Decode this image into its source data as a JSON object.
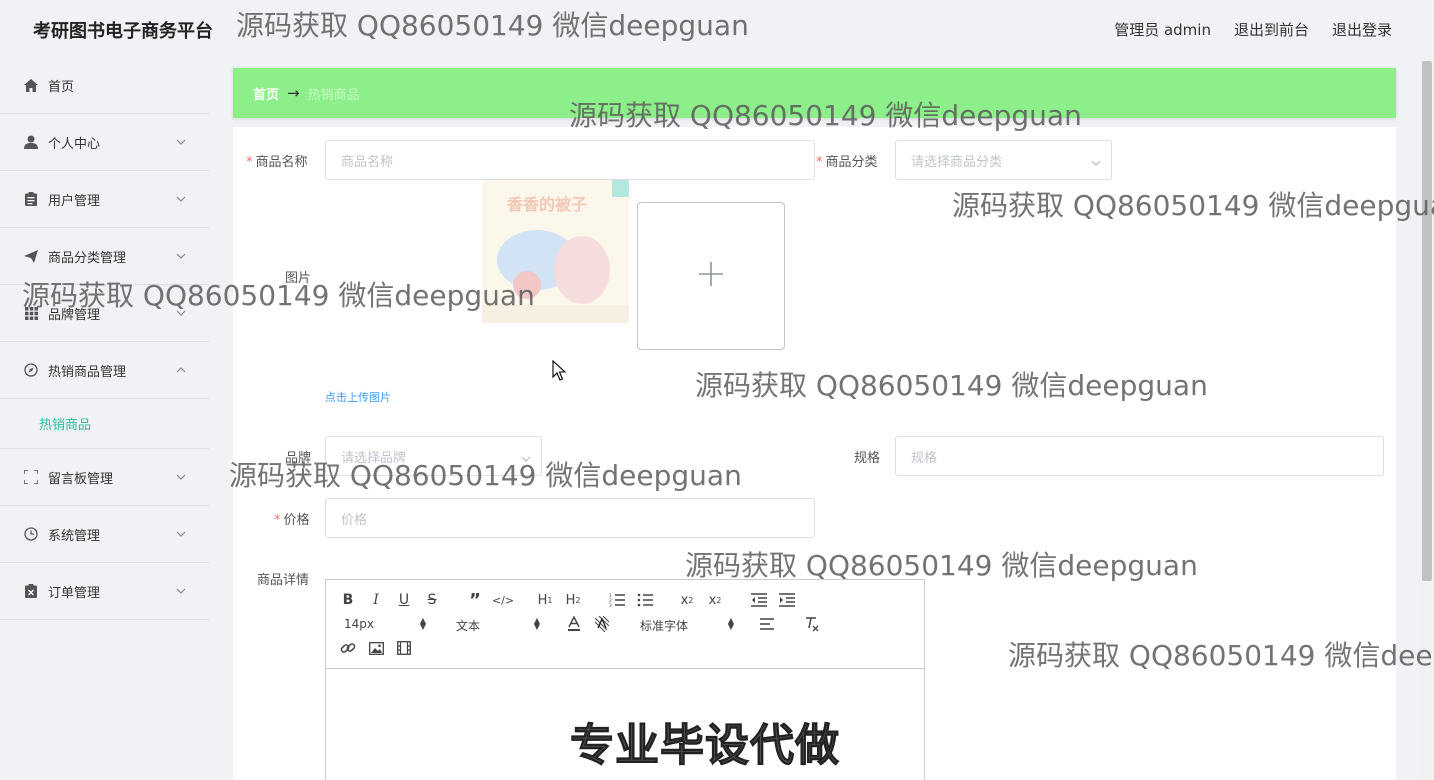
{
  "app": {
    "title": "考研图书电子商务平台"
  },
  "topnav": {
    "user": "管理员 admin",
    "front": "退出到前台",
    "logout": "退出登录"
  },
  "sidebar": {
    "items": [
      {
        "label": "首页",
        "icon": "home-icon"
      },
      {
        "label": "个人中心",
        "icon": "user-icon"
      },
      {
        "label": "用户管理",
        "icon": "clipboard-icon"
      },
      {
        "label": "商品分类管理",
        "icon": "send-icon"
      },
      {
        "label": "品牌管理",
        "icon": "grid-icon"
      },
      {
        "label": "热销商品管理",
        "icon": "compass-icon"
      },
      {
        "label": "留言板管理",
        "icon": "fullscreen-icon"
      },
      {
        "label": "系统管理",
        "icon": "clock-icon"
      },
      {
        "label": "订单管理",
        "icon": "document-icon"
      }
    ],
    "subitem": "热销商品"
  },
  "breadcrumb": {
    "home": "首页",
    "separator": "→",
    "current": "热销商品"
  },
  "form": {
    "name_label": "商品名称",
    "name_placeholder": "商品名称",
    "category_label": "商品分类",
    "category_placeholder": "请选择商品分类",
    "image_label": "图片",
    "upload_text": "点击上传图片",
    "brand_label": "品牌",
    "brand_placeholder": "请选择品牌",
    "spec_label": "规格",
    "spec_placeholder": "规格",
    "price_label": "价格",
    "price_placeholder": "价格",
    "detail_label": "商品详情"
  },
  "editor": {
    "font_size": "14px",
    "block_type": "文本",
    "font_family": "标准字体",
    "content_text": "专业毕设代做"
  },
  "thumb": {
    "title": "香香的被子"
  },
  "watermark": "源码获取 QQ86050149 微信deepguan",
  "colors": {
    "accent": "#8def8a",
    "active": "#2bbd9f",
    "required": "#f56c6c"
  }
}
